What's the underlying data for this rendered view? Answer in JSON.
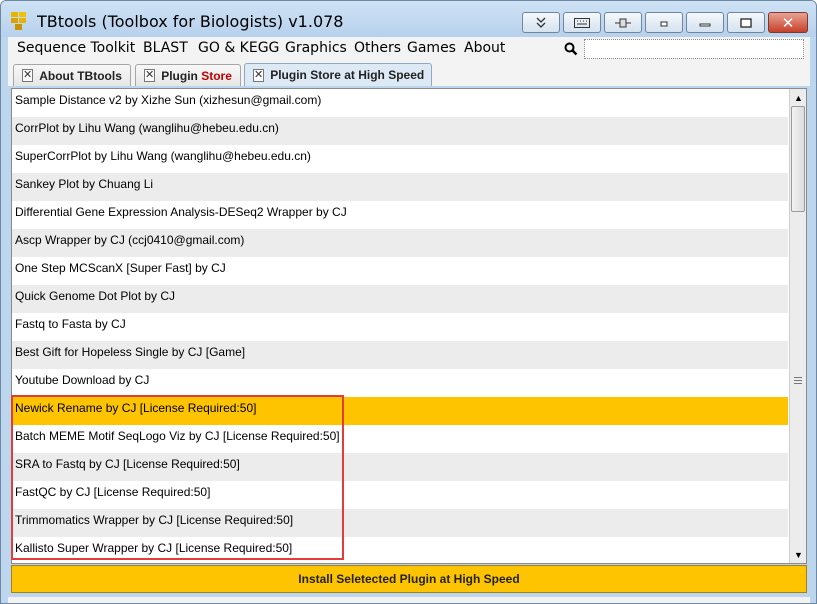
{
  "window": {
    "title": "TBtools (Toolbox for Biologists) v1.078",
    "icon": "tbtools-logo-icon",
    "controls": [
      "collapse-icon",
      "keyboard-icon",
      "pin-icon",
      "minimize-small-icon",
      "minimize-icon",
      "maximize-icon",
      "close-icon"
    ],
    "close_glyph": "✕"
  },
  "menu": {
    "items": [
      "Sequence Toolkit",
      "BLAST",
      "GO & KEGG",
      "Graphics",
      "Others",
      "Games",
      "About"
    ],
    "search_icon": "search-icon",
    "search_value": ""
  },
  "tabs": [
    {
      "label": "About TBtools",
      "close": "✕"
    },
    {
      "label_main": "Plugin ",
      "label_red": "Store",
      "close": "✕"
    },
    {
      "label": "Plugin Store at High Speed",
      "close": "✕",
      "active": true
    }
  ],
  "plugins": [
    "Sample Distance v2 by Xizhe Sun (xizhesun@gmail.com)",
    "CorrPlot by Lihu Wang (wanglihu@hebeu.edu.cn)",
    "SuperCorrPlot by Lihu Wang (wanglihu@hebeu.edu.cn)",
    "Sankey Plot by Chuang Li",
    "Differential Gene Expression Analysis-DESeq2 Wrapper by CJ",
    "Ascp Wrapper by CJ (ccj0410@gmail.com)",
    "One Step MCScanX [Super Fast] by CJ",
    "Quick Genome Dot Plot by CJ",
    "Fastq to Fasta by CJ",
    "Best Gift for Hopeless Single by CJ [Game]",
    "Youtube Download by CJ",
    "Newick Rename by CJ [License Required:50]",
    "Batch MEME Motif SeqLogo Viz by CJ [License Required:50]",
    "SRA to Fastq by CJ [License Required:50]",
    "FastQC by CJ [License Required:50]",
    "Trimmomatics Wrapper by CJ [License Required:50]",
    "Kallisto Super Wrapper by CJ [License Required:50]"
  ],
  "selected_index": 11,
  "colors": {
    "selection": "#ffc400",
    "annotation_box": "#e23c3c",
    "install_button": "#ffc400"
  },
  "install_button": "Install Seletected Plugin at High Speed",
  "scroll": {
    "up": "▲",
    "down": "▼"
  }
}
